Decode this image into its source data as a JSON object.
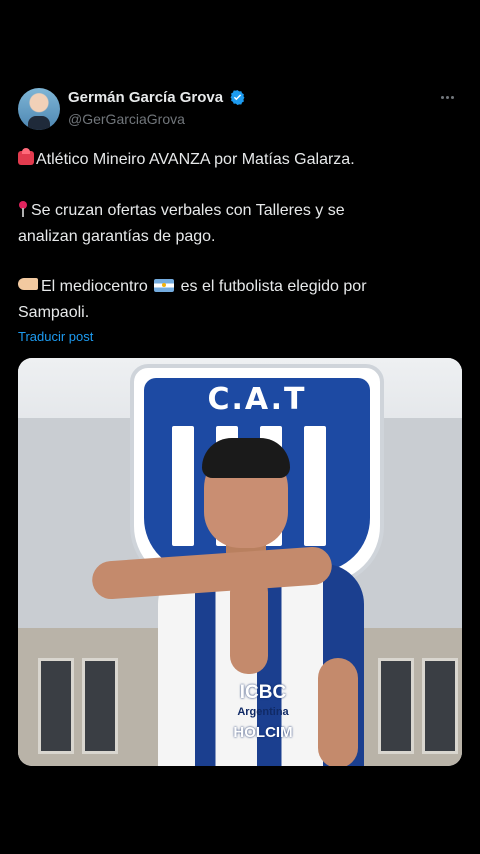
{
  "author": {
    "name": "Germán García Grova",
    "handle": "@GerGarciaGrova",
    "verified_color": "#1d9bf0"
  },
  "post": {
    "line1": "Atlético Mineiro AVANZA por Matías Galarza.",
    "line2a": "Se cruzan ofertas verbales con Talleres y se",
    "line2b": "analizan garantías de pago.",
    "line3a": "El mediocentro",
    "line3b": "es el futbolista elegido por",
    "line3c": "Sampaoli.",
    "emojis": [
      "rotating-light-icon",
      "round-pushpin-icon",
      "pointing-hand-icon",
      "argentina-flag-icon"
    ]
  },
  "translate_label": "Traducir post",
  "media": {
    "crest_text": "C.A.T",
    "sponsor1": "ICBC",
    "sponsor2": "Argentina",
    "sponsor3": "HOLCIM",
    "colors": {
      "club_blue": "#1d4aa3",
      "accent_link": "#1d9bf0"
    }
  }
}
